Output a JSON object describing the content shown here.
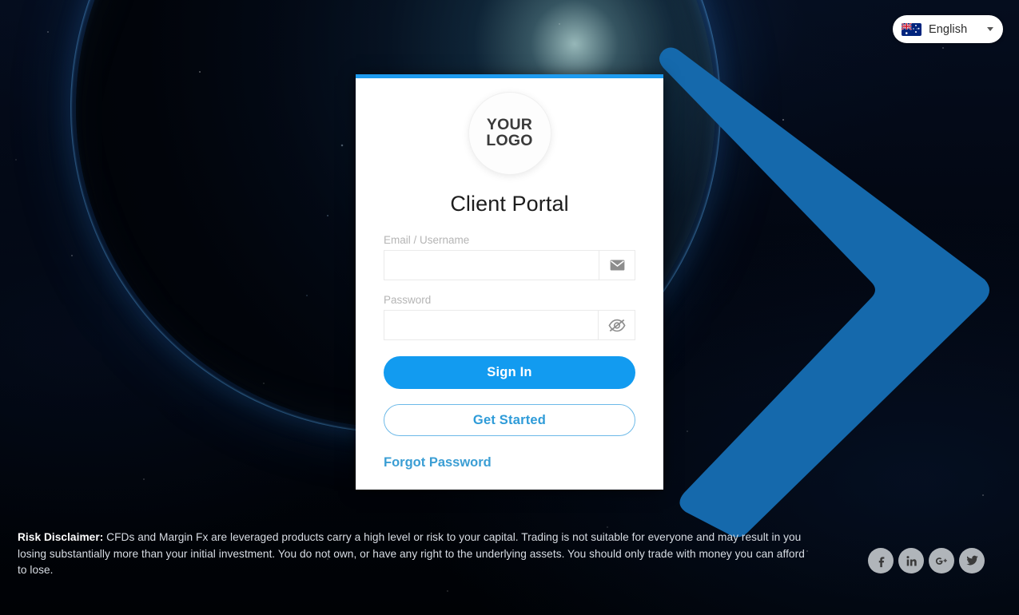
{
  "language_selector": {
    "flag_icon": "australia-flag-icon",
    "label": "English",
    "caret_icon": "chevron-down-icon"
  },
  "card": {
    "logo": {
      "line1": "YOUR",
      "line2": "LOGO"
    },
    "title": "Client Portal",
    "fields": [
      {
        "label": "Email / Username",
        "value": "",
        "placeholder": "",
        "addon_icon": "envelope-icon"
      },
      {
        "label": "Password",
        "value": "",
        "placeholder": "",
        "addon_icon": "eye-slash-icon"
      }
    ],
    "sign_in_label": "Sign In",
    "get_started_label": "Get Started",
    "forgot_password_label": "Forgot Password"
  },
  "disclaimer": {
    "heading": "Risk Disclaimer:",
    "body": "CFDs and Margin Fx are leveraged products carry a high level or risk to your capital. Trading is not suitable for everyone and may result in you losing substantially more than your initial investment. You do not own, or have any right to the underlying assets. You should only trade with money you can afford to lose."
  },
  "socials": [
    {
      "name": "facebook-icon",
      "label": "Facebook"
    },
    {
      "name": "linkedin-icon",
      "label": "LinkedIn"
    },
    {
      "name": "google-plus-icon",
      "label": "Google Plus"
    },
    {
      "name": "twitter-icon",
      "label": "Twitter"
    }
  ],
  "colors": {
    "accent_blue": "#129bf0",
    "chevron_blue": "#1569ac",
    "card_top_bar": "#1e9bef",
    "link_blue": "#3b9ed4"
  }
}
